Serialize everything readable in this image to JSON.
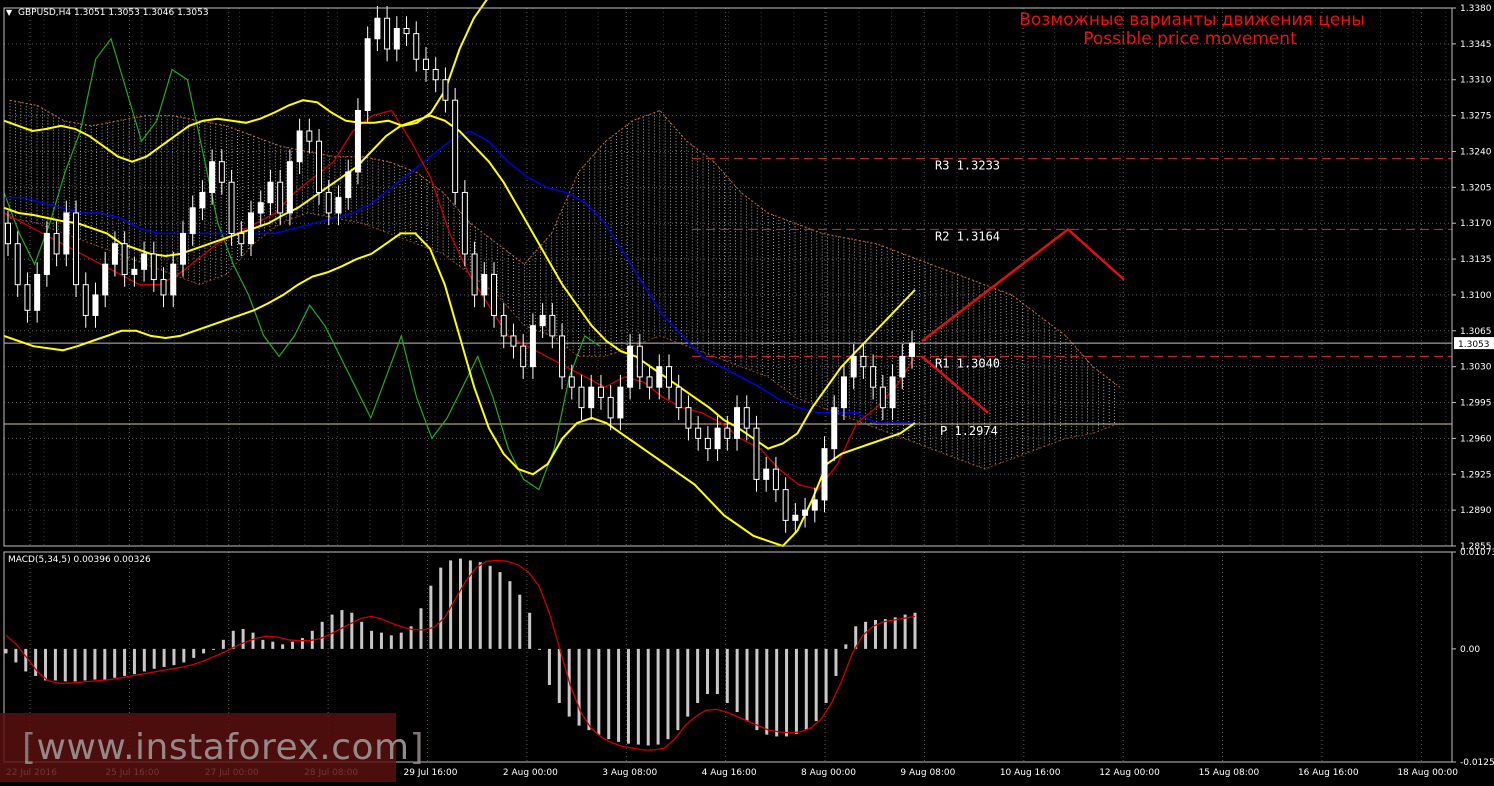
{
  "header": {
    "symbol_line": "GBPUSD,H4  1.3051 1.3053 1.3046 1.3053",
    "title_ru": "Возможные варианты движения цены",
    "title_en": "Possible price movement"
  },
  "macd_label": "MACD(5,34,5) 0.00396 0.00326",
  "watermark": {
    "open": "[",
    "text": " www.instaforex.com ",
    "close": "]"
  },
  "colors": {
    "background": "#000000",
    "candle": "#ffffff",
    "bollinger": "#ffff00",
    "kijun": "#0000dd",
    "tenkan": "#cc0000",
    "chikou": "#22aa22",
    "cloud": "#ffffff",
    "level": "#cc3333",
    "forecast": "#dd1111",
    "macd_hist": "#c8c8c8",
    "macd_signal": "#cc0000",
    "grid": "#606060"
  },
  "chart_data": [
    {
      "type": "candlestick",
      "title": "GBPUSD,H4",
      "ylim": [
        1.2855,
        1.338
      ],
      "yticks": [
        "1.3380",
        "1.3345",
        "1.3310",
        "1.3275",
        "1.3240",
        "1.3205",
        "1.3170",
        "1.3135",
        "1.3100",
        "1.3065",
        "1.3030",
        "1.2995",
        "1.2960",
        "1.2925",
        "1.2890",
        "1.2855"
      ],
      "current_price": "1.3053",
      "xticks": [
        "22 Jul 2016",
        "25 Jul 16:00",
        "27 Jul 00:00",
        "28 Jul 08:00",
        "29 Jul 16:00",
        "2 Aug 00:00",
        "3 Aug 08:00",
        "4 Aug 16:00",
        "8 Aug 00:00",
        "9 Aug 08:00",
        "10 Aug 16:00",
        "12 Aug 00:00",
        "15 Aug 08:00",
        "16 Aug 16:00",
        "18 Aug 00:00"
      ],
      "levels": [
        {
          "name": "R3",
          "label": "R3 1.3233",
          "value": 1.3233
        },
        {
          "name": "R2",
          "label": "R2 1.3164",
          "value": 1.3164
        },
        {
          "name": "R1",
          "label": "R1 1.3040",
          "value": 1.304
        },
        {
          "name": "P",
          "label": "P 1.2974",
          "value": 1.2974
        }
      ],
      "forecast": {
        "up_path": [
          1.3055,
          1.3164,
          1.3115
        ],
        "down_path": [
          1.304,
          1.2985
        ]
      },
      "closes": [
        1.315,
        1.311,
        1.3085,
        1.312,
        1.316,
        1.314,
        1.318,
        1.311,
        1.308,
        1.31,
        1.313,
        1.315,
        1.312,
        1.3125,
        1.314,
        1.3115,
        1.31,
        1.313,
        1.316,
        1.3185,
        1.32,
        1.323,
        1.321,
        1.316,
        1.315,
        1.318,
        1.319,
        1.321,
        1.318,
        1.323,
        1.326,
        1.325,
        1.32,
        1.318,
        1.3195,
        1.322,
        1.328,
        1.335,
        1.337,
        1.334,
        1.336,
        1.3355,
        1.333,
        1.332,
        1.331,
        1.329,
        1.32,
        1.314,
        1.31,
        1.312,
        1.308,
        1.306,
        1.305,
        1.303,
        1.307,
        1.308,
        1.306,
        1.302,
        1.301,
        1.299,
        1.301,
        1.3,
        1.298,
        1.301,
        1.305,
        1.302,
        1.301,
        1.303,
        1.301,
        1.299,
        1.297,
        1.296,
        1.295,
        1.297,
        1.296,
        1.299,
        1.297,
        1.292,
        1.293,
        1.291,
        1.288,
        1.2885,
        1.289,
        1.29,
        1.295,
        1.299,
        1.302,
        1.304,
        1.303,
        1.301,
        1.299,
        1.302,
        1.304,
        1.3053
      ],
      "bollinger_upper": [
        1.327,
        1.3265,
        1.326,
        1.3262,
        1.3265,
        1.3262,
        1.3255,
        1.3245,
        1.3235,
        1.323,
        1.3235,
        1.3245,
        1.3255,
        1.3265,
        1.327,
        1.3272,
        1.327,
        1.3268,
        1.3272,
        1.3278,
        1.3285,
        1.329,
        1.3288,
        1.3278,
        1.327,
        1.3268,
        1.3268,
        1.327,
        1.3265,
        1.3268,
        1.3278,
        1.33,
        1.334,
        1.337,
        1.339,
        1.34,
        1.341,
        1.342,
        1.343
      ],
      "bollinger_middle": [
        1.3185,
        1.318,
        1.3178,
        1.3175,
        1.3172,
        1.317,
        1.3165,
        1.316,
        1.315,
        1.3145,
        1.314,
        1.3138,
        1.314,
        1.3145,
        1.315,
        1.3155,
        1.316,
        1.3165,
        1.317,
        1.3178,
        1.3185,
        1.3195,
        1.3205,
        1.3215,
        1.3225,
        1.324,
        1.3255,
        1.3265,
        1.327,
        1.3275,
        1.327,
        1.326,
        1.3245,
        1.323,
        1.321,
        1.3185,
        1.316,
        1.3135,
        1.311,
        1.309,
        1.307,
        1.3055,
        1.3045,
        1.304,
        1.303,
        1.302,
        1.301,
        1.3,
        1.299,
        1.2978,
        1.297,
        1.296,
        1.295,
        1.2955,
        1.2965,
        1.299,
        1.301,
        1.303,
        1.3045,
        1.306,
        1.3075,
        1.309,
        1.3105
      ],
      "bollinger_lower": [
        1.306,
        1.3055,
        1.305,
        1.3048,
        1.3046,
        1.305,
        1.3055,
        1.306,
        1.3065,
        1.3065,
        1.306,
        1.3058,
        1.306,
        1.3065,
        1.307,
        1.3075,
        1.308,
        1.3085,
        1.3092,
        1.31,
        1.311,
        1.3118,
        1.3122,
        1.3128,
        1.3135,
        1.314,
        1.315,
        1.316,
        1.316,
        1.3145,
        1.311,
        1.306,
        1.301,
        1.297,
        1.2945,
        1.293,
        1.2925,
        1.2935,
        1.296,
        1.2975,
        1.298,
        1.2975,
        1.2965,
        1.2955,
        1.2945,
        1.2935,
        1.2925,
        1.2915,
        1.29,
        1.2885,
        1.2875,
        1.2865,
        1.286,
        1.2855,
        1.287,
        1.29,
        1.2935,
        1.2945,
        1.295,
        1.2955,
        1.296,
        1.2965,
        1.2975
      ],
      "kijun_sen": [
        1.3195,
        1.3195,
        1.319,
        1.3185,
        1.318,
        1.318,
        1.3175,
        1.3165,
        1.316,
        1.316,
        1.316,
        1.316,
        1.316,
        1.316,
        1.316,
        1.3165,
        1.317,
        1.3175,
        1.318,
        1.319,
        1.3205,
        1.322,
        1.3235,
        1.325,
        1.326,
        1.325,
        1.323,
        1.3215,
        1.3205,
        1.32,
        1.319,
        1.317,
        1.314,
        1.311,
        1.308,
        1.306,
        1.304,
        1.303,
        1.302,
        1.301,
        1.2998,
        1.299,
        1.2985,
        1.2985,
        1.2985,
        1.2975,
        1.2975,
        1.2975
      ],
      "tenkan_sen": [
        1.318,
        1.317,
        1.316,
        1.315,
        1.314,
        1.313,
        1.312,
        1.311,
        1.311,
        1.312,
        1.3135,
        1.315,
        1.316,
        1.317,
        1.318,
        1.32,
        1.3215,
        1.323,
        1.326,
        1.3275,
        1.328,
        1.325,
        1.3215,
        1.316,
        1.312,
        1.309,
        1.306,
        1.305,
        1.304,
        1.303,
        1.302,
        1.301,
        1.302,
        1.3015,
        1.3,
        1.299,
        1.2985,
        1.2975,
        1.296,
        1.295,
        1.293,
        1.2915,
        1.291,
        1.2935,
        1.2975,
        1.299,
        1.301,
        1.304
      ],
      "chikou_span": [
        1.32,
        1.316,
        1.313,
        1.317,
        1.322,
        1.326,
        1.333,
        1.335,
        1.33,
        1.325,
        1.327,
        1.332,
        1.331,
        1.324,
        1.317,
        1.313,
        1.31,
        1.306,
        1.304,
        1.306,
        1.309,
        1.307,
        1.304,
        1.301,
        1.298,
        1.302,
        1.306,
        1.3,
        1.296,
        1.298,
        1.301,
        1.304,
        1.3,
        1.295,
        1.292,
        1.291,
        1.295,
        1.302,
        1.306,
        1.305
      ],
      "cloud_top": [
        1.329,
        1.3285,
        1.327,
        1.3265,
        1.327,
        1.3275,
        1.3275,
        1.327,
        1.3265,
        1.3255,
        1.3245,
        1.324,
        1.3235,
        1.3235,
        1.323,
        1.322,
        1.32,
        1.317,
        1.315,
        1.313,
        1.316,
        1.322,
        1.325,
        1.327,
        1.328,
        1.325,
        1.323,
        1.32,
        1.318,
        1.317,
        1.316,
        1.3155,
        1.315,
        1.314,
        1.313,
        1.312,
        1.311,
        1.31,
        1.308,
        1.306,
        1.303,
        1.301
      ],
      "cloud_bottom": [
        1.3175,
        1.317,
        1.316,
        1.315,
        1.314,
        1.313,
        1.312,
        1.311,
        1.312,
        1.315,
        1.317,
        1.318,
        1.3175,
        1.317,
        1.316,
        1.315,
        1.314,
        1.312,
        1.31,
        1.307,
        1.306,
        1.304,
        1.304,
        1.305,
        1.306,
        1.305,
        1.304,
        1.303,
        1.302,
        1.3,
        1.299,
        1.298,
        1.297,
        1.296,
        1.295,
        1.294,
        1.293,
        1.294,
        1.295,
        1.296,
        1.2965,
        1.2975
      ]
    },
    {
      "type": "bar",
      "title": "MACD(5,34,5) 0.00396 0.00326",
      "ylim": [
        -0.01253,
        0.01073
      ],
      "yticks": [
        "0.01073",
        "0.00",
        "-0.01253"
      ],
      "histogram": [
        -0.0005,
        -0.0015,
        -0.0025,
        -0.003,
        -0.0035,
        -0.0035,
        -0.0036,
        -0.0036,
        -0.0035,
        -0.0034,
        -0.0034,
        -0.0032,
        -0.003,
        -0.0028,
        -0.0025,
        -0.0022,
        -0.002,
        -0.0018,
        -0.0015,
        -0.001,
        -0.0005,
        0.0,
        0.001,
        0.002,
        0.0022,
        0.0018,
        0.001,
        0.0008,
        0.0005,
        0.0008,
        0.0012,
        0.002,
        0.003,
        0.0038,
        0.0043,
        0.004,
        0.003,
        0.002,
        0.0018,
        0.0015,
        0.0018,
        0.0025,
        0.0045,
        0.007,
        0.009,
        0.0098,
        0.01,
        0.0098,
        0.0096,
        0.0092,
        0.0085,
        0.0075,
        0.006,
        0.004,
        0.0,
        -0.004,
        -0.006,
        -0.0075,
        -0.0085,
        -0.009,
        -0.0095,
        -0.01,
        -0.0103,
        -0.0105,
        -0.0106,
        -0.0107,
        -0.0106,
        -0.01,
        -0.009,
        -0.0075,
        -0.006,
        -0.005,
        -0.005,
        -0.006,
        -0.007,
        -0.008,
        -0.009,
        -0.0095,
        -0.0097,
        -0.0097,
        -0.0094,
        -0.009,
        -0.008,
        -0.006,
        -0.003,
        0.0005,
        0.0025,
        0.003,
        0.0032,
        0.0033,
        0.0035,
        0.0038,
        0.004
      ],
      "signal": [
        0.0015,
        0.0005,
        -0.001,
        -0.0025,
        -0.0035,
        -0.0038,
        -0.0038,
        -0.0037,
        -0.0036,
        -0.0035,
        -0.0034,
        -0.0032,
        -0.003,
        -0.0028,
        -0.0026,
        -0.0024,
        -0.0022,
        -0.002,
        -0.0017,
        -0.0013,
        -0.0008,
        -0.0003,
        0.0003,
        0.0008,
        0.0012,
        0.0014,
        0.0013,
        0.001,
        0.0009,
        0.0009,
        0.0011,
        0.0016,
        0.0022,
        0.0028,
        0.0034,
        0.0036,
        0.0033,
        0.0028,
        0.0024,
        0.0021,
        0.0021,
        0.0024,
        0.0035,
        0.0055,
        0.0075,
        0.009,
        0.0097,
        0.0098,
        0.0097,
        0.0093,
        0.0085,
        0.007,
        0.004,
        0.0,
        -0.004,
        -0.007,
        -0.0088,
        -0.0098,
        -0.0104,
        -0.0108,
        -0.011,
        -0.0112,
        -0.0112,
        -0.011,
        -0.01,
        -0.0085,
        -0.0075,
        -0.0068,
        -0.0067,
        -0.007,
        -0.0075,
        -0.008,
        -0.0085,
        -0.009,
        -0.0092,
        -0.0093,
        -0.0092,
        -0.0088,
        -0.0078,
        -0.006,
        -0.0035,
        -0.0005,
        0.0015,
        0.0025,
        0.003,
        0.0032,
        0.0034,
        0.0036
      ]
    }
  ]
}
